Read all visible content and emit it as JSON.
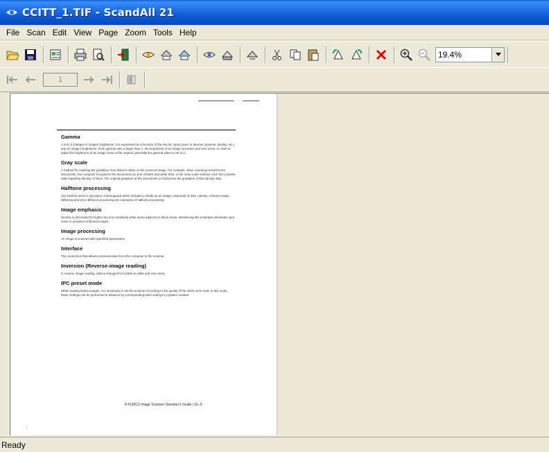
{
  "window": {
    "title": "CCITT_1.TIF - ScandAll 21"
  },
  "menu": {
    "items": [
      "File",
      "Scan",
      "Edit",
      "View",
      "Page",
      "Zoom",
      "Tools",
      "Help"
    ]
  },
  "toolbar": {
    "zoom_value": "19.4%"
  },
  "nav": {
    "page_number": "1"
  },
  "document": {
    "sections": [
      {
        "heading": "Gamma",
        "body": "A unit of changes of images' brightness. It is expressed as a function of the electric input power to devices (scanner, display, etc.) and an image's brightness. If the gamma rate is larger than 1, the brightness of an image increases and vice versa. In order to adjust the brightness of an image close to the original, generally the gamma value is set to 1."
      },
      {
        "heading": "Gray scale",
        "body": "A method for realizing the gradation from black to white on the scanned image. For example, when scanning monochrome documents, the computer recognizes the documents as sets of black and white dots. In the Gray scale method, each dot contains data regarding density of black. The original gradation of the documents is realized as the gradation of this density data."
      },
      {
        "heading": "Halftone processing",
        "body": "Any method used to reproduce a photograph which includes a shade as an image composed of dots, namely, a binary image. Dithering and error diffusion processing are examples of halftone processing."
      },
      {
        "heading": "Image emphasis",
        "body": "Density is decreased for lighter but not completely white areas adjacent to black areas. Weakening this emphasis eliminates spot noise or produces softened images."
      },
      {
        "heading": "Image processing",
        "body": "An image is scanned with specified parameters."
      },
      {
        "heading": "Interface",
        "body": "The connection that allows communication from the computer to the scanner."
      },
      {
        "heading": "Inversion (Reverse-image reading)",
        "body": "In reverse image reading, data is changed from black to white and vice versa."
      },
      {
        "heading": "IPC preset mode",
        "body": "While reading binary images, it is necessary to set the scanner according to the quality of the sheet to be read. In this mode, these settings can be preformed in advance by corresponding each setting to a pattern number."
      }
    ],
    "footer": "fi-4120C2 Image Scanner Operator's Guide  |  GL-5",
    "corner_mark": ":"
  },
  "status": {
    "text": "Ready"
  }
}
